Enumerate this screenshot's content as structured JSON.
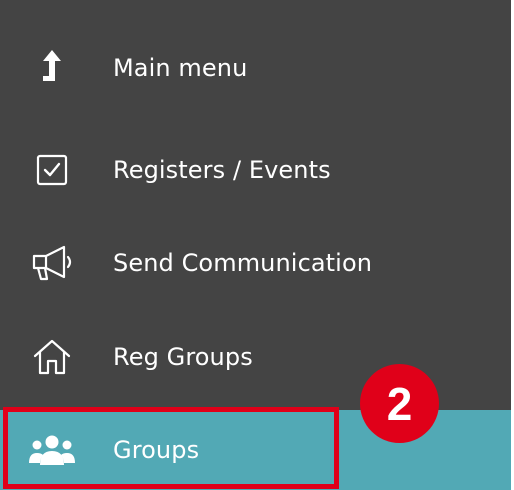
{
  "menu": {
    "items": [
      {
        "label": "Main menu",
        "icon": "arrow-up-icon"
      },
      {
        "label": "Registers / Events",
        "icon": "checkbox-icon"
      },
      {
        "label": "Send Communication",
        "icon": "megaphone-icon"
      },
      {
        "label": "Reg Groups",
        "icon": "home-icon"
      },
      {
        "label": "Groups",
        "icon": "users-icon",
        "active": true
      }
    ]
  },
  "annotation": {
    "step_number": "2"
  },
  "colors": {
    "panel_bg": "#444444",
    "active_bg": "#52a9b5",
    "highlight": "#e00019",
    "text": "#ffffff"
  }
}
